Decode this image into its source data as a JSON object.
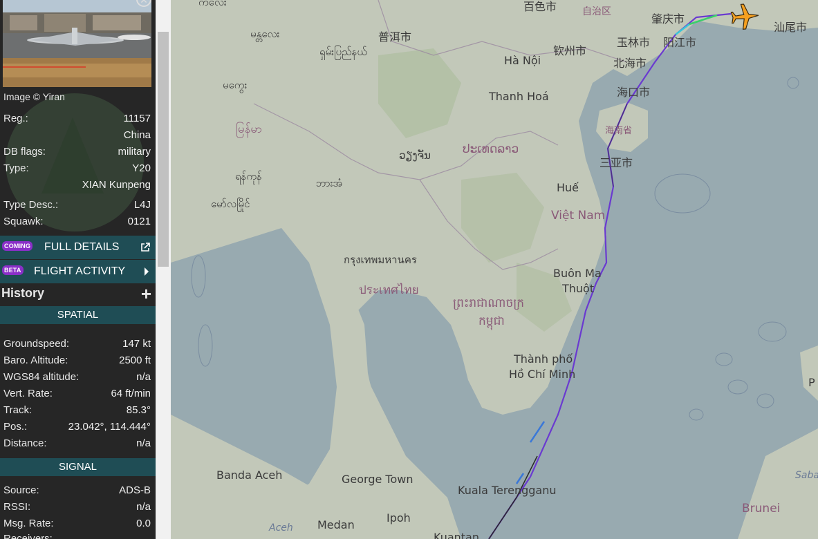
{
  "photo": {
    "credit": "Image © Yiran"
  },
  "aircraft": {
    "fields": [
      {
        "label": "Reg.:",
        "value": "11157"
      },
      {
        "label": "",
        "value": "China"
      },
      {
        "label": "DB flags:",
        "value": "military"
      },
      {
        "label": "Type:",
        "value": "Y20"
      },
      {
        "label": "",
        "value": "XIAN Kunpeng"
      },
      {
        "label": "Type Desc.:",
        "value": "L4J"
      },
      {
        "label": "Squawk:",
        "value": "0121"
      }
    ]
  },
  "links": {
    "full_details": {
      "badge": "COMING",
      "label": "FULL DETAILS"
    },
    "flight_activity": {
      "badge": "BETA",
      "label": "FLIGHT ACTIVITY"
    }
  },
  "history": {
    "title": "History"
  },
  "spatial": {
    "title": "SPATIAL",
    "fields": [
      {
        "label": "Groundspeed:",
        "value": "147 kt"
      },
      {
        "label": "Baro. Altitude:",
        "value": "2500 ft"
      },
      {
        "label": "WGS84 altitude:",
        "value": "n/a"
      },
      {
        "label": "Vert. Rate:",
        "value": "64 ft/min"
      },
      {
        "label": "Track:",
        "value": "85.3°"
      },
      {
        "label": "Pos.:",
        "value": "23.042°, 114.444°"
      },
      {
        "label": "Distance:",
        "value": "n/a"
      }
    ]
  },
  "signal": {
    "title": "SIGNAL",
    "fields": [
      {
        "label": "Source:",
        "value": "ADS-B"
      },
      {
        "label": "RSSI:",
        "value": "n/a"
      },
      {
        "label": "Msg. Rate:",
        "value": "0.0"
      },
      {
        "label": "Receivers:",
        "value": ""
      }
    ]
  },
  "map": {
    "labels": {
      "baise": "百色市",
      "zizhiqu": "自治区",
      "zhaoqing": "肇庆市",
      "shanwei": "汕尾市",
      "puer": "普洱市",
      "yulin": "玉林市",
      "yangjiang": "阳江市",
      "qinzhou": "钦州市",
      "beihai": "北海市",
      "hanoi": "Hà Nội",
      "haikou": "海口市",
      "thanhhoa": "Thanh Hoá",
      "hainan": "海南省",
      "sanya": "三亚市",
      "vientiane": "ວຽງຈັນ",
      "laos": "ປະເທດລາວ",
      "hue": "Huế",
      "vietnam": "Việt Nam",
      "myanmar": "မြန်မာ",
      "mandalay": "မန္တလေး",
      "magway": "မကွေး",
      "yangon": "ရန်ကုန်",
      "mawlamyine": "မော်လမြိုင်",
      "myeik": "ဘားအံ",
      "shan": "ရှမ်းပြည်နယ်",
      "kholes": "ကလေး",
      "bangkok": "กรุงเทพมหานคร",
      "thailand": "ประเทศไทย",
      "cambodia_1": "ព្រះរាជាណាចក្រ",
      "cambodia_2": "កម្ពុជា",
      "buonmathuot_1": "Buôn Ma",
      "buonmathuot_2": "Thuột",
      "hcmc_1": "Thành phố",
      "hcmc_2": "Hồ Chí Minh",
      "bandaaceh": "Banda Aceh",
      "aceh": "Aceh",
      "georgetown": "George Town",
      "kualaterengganu": "Kuala Terengganu",
      "ipoh": "Ipoh",
      "medan": "Medan",
      "kuantan": "Kuantan",
      "brunei": "Brunei",
      "saba": "Saba",
      "p": "P"
    },
    "colors": {
      "water": "#98aab0",
      "land": "#c2c8b9",
      "track_purple": "#6a3ad0",
      "plane": "#f5a020"
    }
  }
}
